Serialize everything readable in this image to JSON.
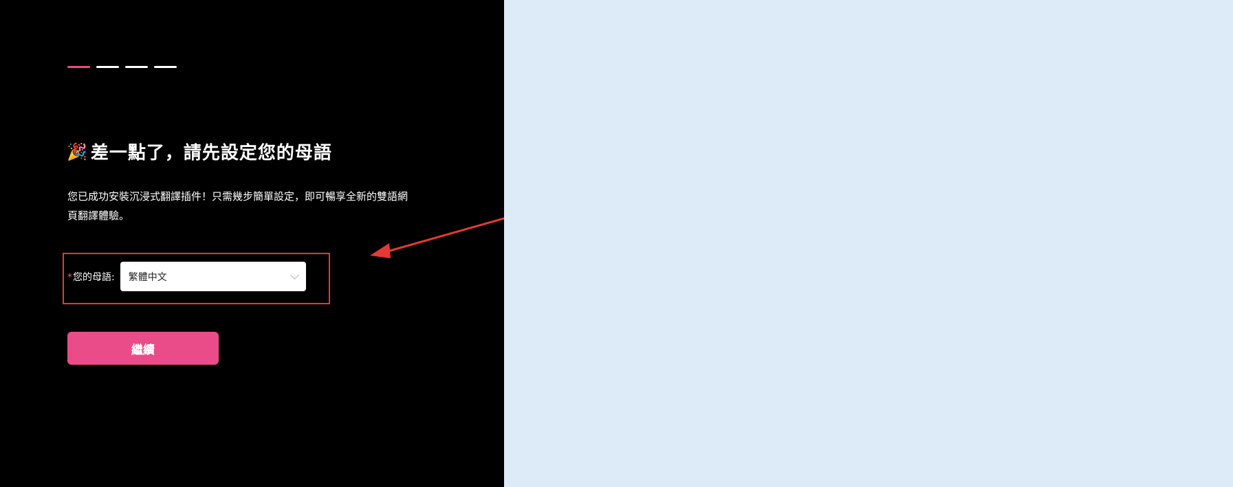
{
  "onboarding": {
    "steps": [
      {
        "active": true
      },
      {
        "active": false
      },
      {
        "active": false
      },
      {
        "active": false
      }
    ],
    "title": "差一點了，請先設定您的母語",
    "title_icon": "party-popper-icon",
    "description": "您已成功安裝沉浸式翻譯插件！只需幾步簡單設定，即可暢享全新的雙語網頁翻譯體驗。",
    "native_language": {
      "required_mark": "*",
      "label": "您的母語:",
      "selected_value": "繁體中文"
    },
    "continue_label": "繼續"
  },
  "annotation": {
    "color": "#e53935"
  },
  "colors": {
    "accent": "#ea4c89",
    "left_bg": "#000000",
    "right_bg": "#dcebf7",
    "blue_accent": "#3aa0f0"
  }
}
